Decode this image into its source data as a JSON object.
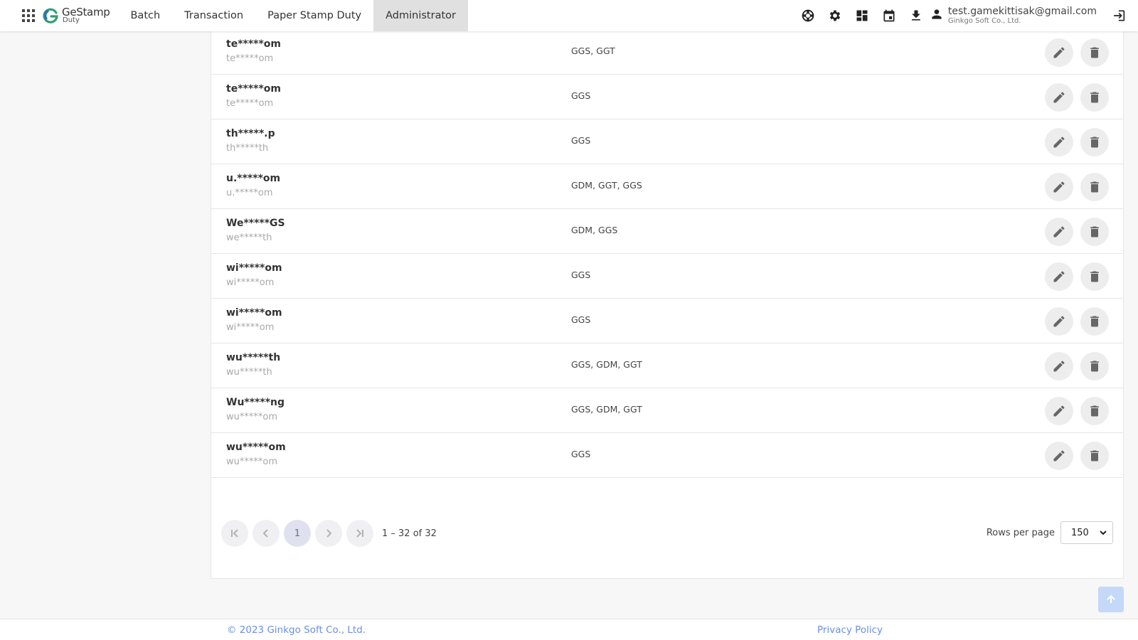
{
  "header": {
    "logo_name": "GeStamp",
    "logo_sub": "Duty",
    "nav": [
      "Batch",
      "Transaction",
      "Paper Stamp Duty",
      "Administrator"
    ],
    "active_nav": "Administrator",
    "icons": [
      "support-icon",
      "settings-icon",
      "dashboard-icon",
      "calendar-icon",
      "download-icon"
    ],
    "user_email": "test.gamekittisak@gmail.com",
    "user_company": "Ginkgo Soft Co., Ltd."
  },
  "rows": [
    {
      "name": "te*****om",
      "sub": "te*****om",
      "groups": "GGS, GGT"
    },
    {
      "name": "te*****om",
      "sub": "te*****om",
      "groups": "GGS"
    },
    {
      "name": "th*****.p",
      "sub": "th*****th",
      "groups": "GGS"
    },
    {
      "name": "u.*****om",
      "sub": "u.*****om",
      "groups": "GDM, GGT, GGS"
    },
    {
      "name": "We*****GS",
      "sub": "we*****th",
      "groups": "GDM, GGS"
    },
    {
      "name": "wi*****om",
      "sub": "wi*****om",
      "groups": "GGS"
    },
    {
      "name": "wi*****om",
      "sub": "wi*****om",
      "groups": "GGS"
    },
    {
      "name": "wu*****th",
      "sub": "wu*****th",
      "groups": "GGS, GDM, GGT"
    },
    {
      "name": "Wu*****ng",
      "sub": "wu*****om",
      "groups": "GGS, GDM, GGT"
    },
    {
      "name": "wu*****om",
      "sub": "wu*****om",
      "groups": "GGS"
    }
  ],
  "pagination": {
    "current_page": "1",
    "range_text": "1 – 32 of 32",
    "rows_per_page_label": "Rows per page",
    "rows_per_page_value": "150"
  },
  "footer": {
    "copyright": "© 2023 Ginkgo Soft Co., Ltd.",
    "privacy": "Privacy Policy"
  },
  "colors": {
    "accent": "#6d8fe0",
    "active_nav_bg": "#e0e0e0",
    "action_button_bg": "#ededed"
  }
}
